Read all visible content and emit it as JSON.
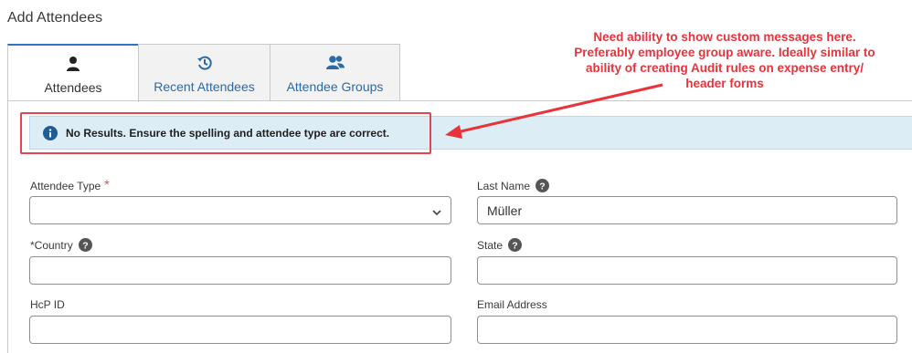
{
  "page": {
    "title": "Add Attendees"
  },
  "tabs": [
    {
      "label": "Attendees",
      "icon": "person-icon",
      "active": true
    },
    {
      "label": "Recent Attendees",
      "icon": "history-icon",
      "active": false
    },
    {
      "label": "Attendee Groups",
      "icon": "group-icon",
      "active": false
    }
  ],
  "alert": {
    "message": "No Results. Ensure the spelling and attendee type are correct."
  },
  "annotation": {
    "text": "Need ability to show custom messages here. Preferably employee group aware. Ideally similar to ability of creating Audit rules on expense entry/ header forms",
    "color": "#e8333a"
  },
  "form": {
    "attendee_type": {
      "label": "Attendee Type",
      "required_mark": "*",
      "value": ""
    },
    "last_name": {
      "label": "Last Name",
      "value": "Müller"
    },
    "country": {
      "label": "*Country",
      "value": ""
    },
    "state": {
      "label": "State",
      "value": ""
    },
    "hcp_id": {
      "label": "HcP ID",
      "value": ""
    },
    "email": {
      "label": "Email Address",
      "value": ""
    }
  },
  "colors": {
    "accent": "#2e76c2",
    "alert_bg": "#dcedf5",
    "highlight": "#e0464b"
  }
}
